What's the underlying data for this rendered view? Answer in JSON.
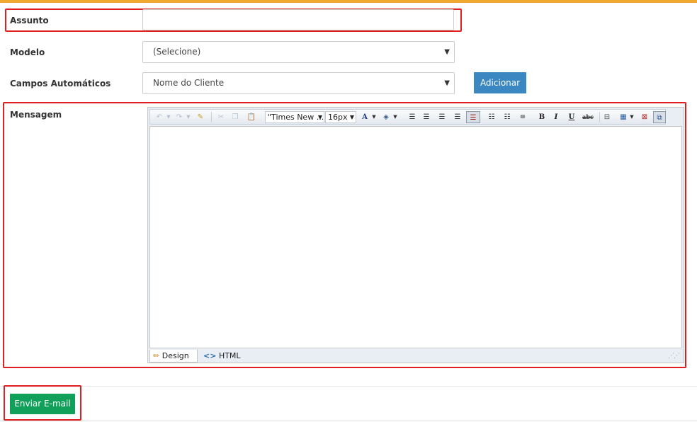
{
  "form": {
    "subject": {
      "label": "Assunto",
      "value": ""
    },
    "template": {
      "label": "Modelo",
      "selected": "(Selecione)"
    },
    "auto_fields": {
      "label": "Campos Automáticos",
      "selected": "Nome do Cliente",
      "add_button": "Adicionar"
    },
    "message": {
      "label": "Mensagem"
    }
  },
  "editor": {
    "font_family": "\"Times New ...",
    "font_size": "16px",
    "modes": {
      "design": "Design",
      "html": "HTML"
    },
    "icons": [
      "undo-icon",
      "redo-icon",
      "eraser-icon",
      "cut-icon",
      "copy-icon",
      "paste-icon",
      "font-color-icon",
      "highlight-icon",
      "align-left-icon",
      "align-center-icon",
      "align-right-icon",
      "justify-icon",
      "justify-full-icon",
      "bullet-list-icon",
      "numbered-list-icon",
      "indent-icon",
      "bold-icon",
      "italic-icon",
      "underline-icon",
      "strikethrough-icon",
      "horizontal-rule-icon",
      "table-icon",
      "delete-table-icon",
      "fullscreen-icon"
    ],
    "glyphs": {
      "bold": "B",
      "italic": "I",
      "underline": "U",
      "strike": "abc",
      "font_color": "A"
    }
  },
  "footer": {
    "send_button": "Enviar E-mail"
  },
  "colors": {
    "accent_top": "#f0a830",
    "add_button": "#3a87c1",
    "send_button": "#11a05a",
    "highlight": "#e02020"
  }
}
